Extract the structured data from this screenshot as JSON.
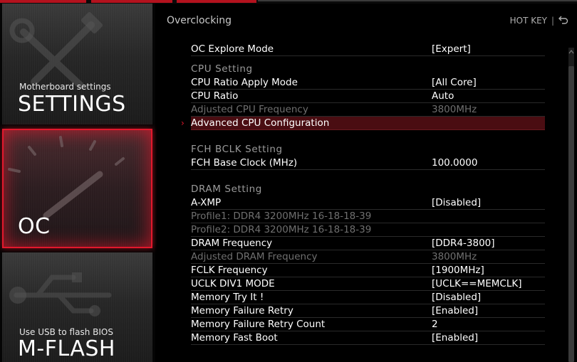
{
  "sidebar": {
    "settings": {
      "subtitle": "Motherboard settings",
      "title": "SETTINGS"
    },
    "oc": {
      "title": "OC"
    },
    "mflash": {
      "subtitle": "Use USB to flash BIOS",
      "title": "M-FLASH"
    }
  },
  "header": {
    "title": "Overclocking",
    "hotkey_label": "HOT KEY",
    "separator": "|",
    "back_icon": "back-arrow-icon"
  },
  "list": {
    "oc_explore_mode": {
      "label": "OC Explore Mode",
      "value": "[Expert]"
    },
    "cpu_section": "CPU  Setting",
    "cpu_rows": [
      {
        "label": "CPU Ratio Apply Mode",
        "value": "[All Core]"
      },
      {
        "label": "CPU Ratio",
        "value": "Auto"
      },
      {
        "label": "Adjusted CPU Frequency",
        "value": "3800MHz"
      },
      {
        "label": "Advanced CPU Configuration",
        "value": ""
      }
    ],
    "fch_section": "FCH  BCLK  Setting",
    "fch_rows": [
      {
        "label": "FCH Base Clock (MHz)",
        "value": "100.0000"
      }
    ],
    "dram_section": "DRAM  Setting",
    "dram_rows": [
      {
        "label": "A-XMP",
        "value": "[Disabled]"
      },
      {
        "label": "Profile1: DDR4 3200MHz 16-18-18-39",
        "value": ""
      },
      {
        "label": "Profile2: DDR4 3200MHz 16-18-18-39",
        "value": ""
      },
      {
        "label": "DRAM Frequency",
        "value": "[DDR4-3800]"
      },
      {
        "label": "Adjusted DRAM Frequency",
        "value": "3800MHz"
      },
      {
        "label": "FCLK Frequency",
        "value": "[1900MHz]"
      },
      {
        "label": "UCLK DIV1 MODE",
        "value": "[UCLK==MEMCLK]"
      },
      {
        "label": "Memory Try It !",
        "value": "[Disabled]"
      },
      {
        "label": "Memory Failure Retry",
        "value": "[Enabled]"
      },
      {
        "label": "Memory Failure Retry Count",
        "value": "2"
      },
      {
        "label": "Memory Fast Boot",
        "value": "[Enabled]"
      }
    ],
    "selected_marker": "›"
  },
  "colors": {
    "accent": "#e2182c",
    "selected_bg": "#4a0d12",
    "dim_text": "#6f6f6f"
  }
}
